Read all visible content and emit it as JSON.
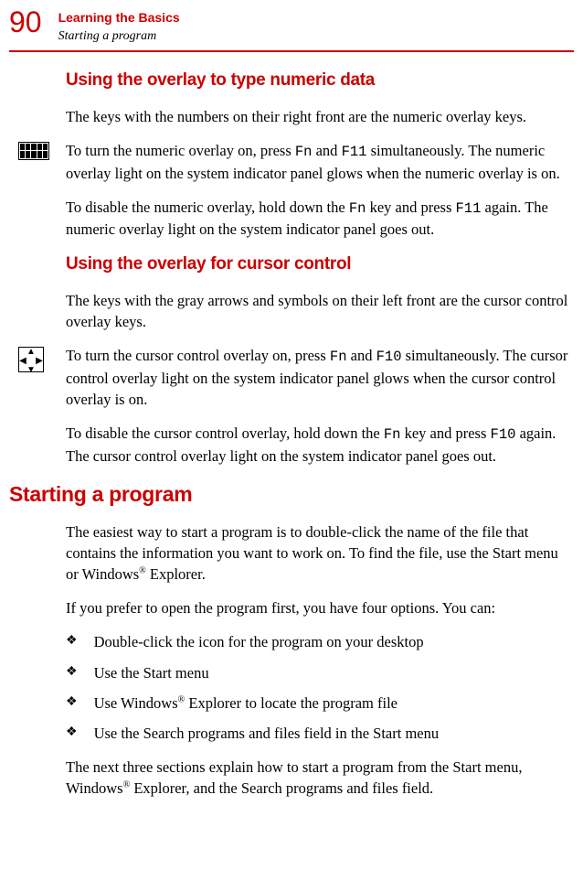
{
  "header": {
    "page_number": "90",
    "chapter": "Learning the Basics",
    "section": "Starting a program"
  },
  "section1": {
    "title": "Using the overlay to type numeric data",
    "p1": "The keys with the numbers on their right front are the numeric overlay keys.",
    "p2a": "To turn the numeric overlay on, press ",
    "p2b": "Fn",
    "p2c": " and ",
    "p2d": "F11",
    "p2e": " simultaneously. The numeric overlay light on the system indicator panel glows when the numeric overlay is on.",
    "p3a": "To disable the numeric overlay, hold down the ",
    "p3b": "Fn",
    "p3c": " key and press ",
    "p3d": "F11",
    "p3e": " again. The numeric overlay light on the system indicator panel goes out."
  },
  "section2": {
    "title": "Using the overlay for cursor control",
    "p1": "The keys with the gray arrows and symbols on their left front are the cursor control overlay keys.",
    "p2a": "To turn the cursor control overlay on, press ",
    "p2b": "Fn",
    "p2c": " and ",
    "p2d": "F10",
    "p2e": " simultaneously. The cursor control overlay light on the system indicator panel glows when the cursor control overlay is on.",
    "p3a": "To disable the cursor control overlay, hold down the ",
    "p3b": "Fn",
    "p3c": " key and press ",
    "p3d": "F10",
    "p3e": " again. The cursor control overlay light on the system indicator panel goes out."
  },
  "section3": {
    "title": "Starting a program",
    "p1a": "The easiest way to start a program is to double-click the name of the file that contains the information you want to work on. To find the file, use the Start menu or Windows",
    "p1b": "®",
    "p1c": " Explorer.",
    "p2": "If you prefer to open the program first, you have four options. You can:",
    "bullets": {
      "b1": "Double-click the icon for the program on your desktop",
      "b2": "Use the Start menu",
      "b3a": "Use Windows",
      "b3b": "®",
      "b3c": " Explorer to locate the program file",
      "b4": "Use the Search programs and files field in the Start menu"
    },
    "p3a": "The next three sections explain how to start a program from the Start menu, Windows",
    "p3b": "®",
    "p3c": " Explorer, and the Search programs and files field."
  },
  "bullet_glyph": "❖"
}
